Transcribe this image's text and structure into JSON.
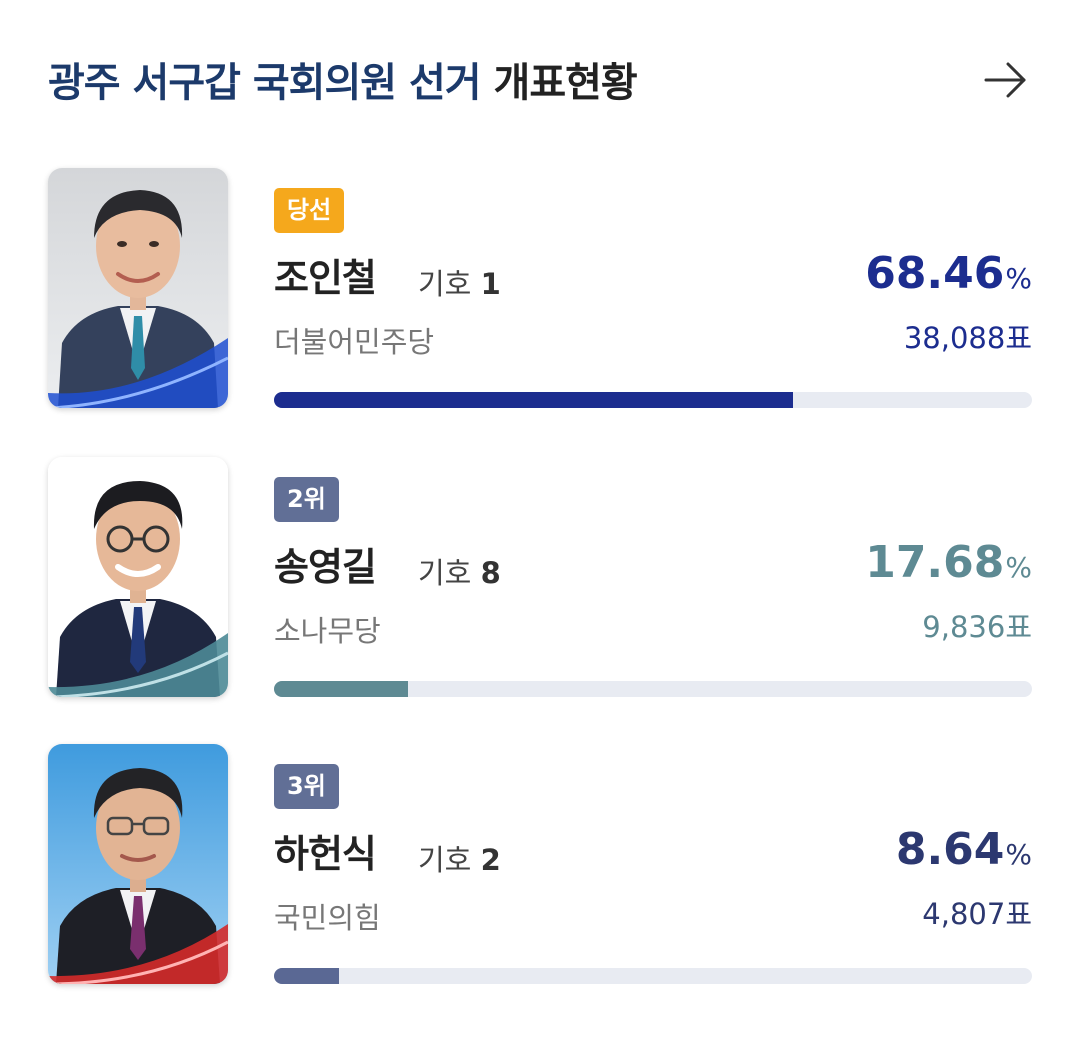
{
  "header": {
    "title_region": "광주 서구갑 국회의원 선거",
    "title_suffix": "개표현황",
    "arrow_icon": "arrow-right-icon"
  },
  "candidates": [
    {
      "badge": "당선",
      "badge_type": "winner",
      "name": "조인철",
      "number_label": "기호",
      "number": "1",
      "party": "더불어민주당",
      "percent": "68.46",
      "percent_unit": "%",
      "votes": "38,088표",
      "share": 0.6846,
      "color": "#1c2d8f",
      "photo_accent": "#1f4fd1"
    },
    {
      "badge": "2위",
      "badge_type": "rank",
      "name": "송영길",
      "number_label": "기호",
      "number": "8",
      "party": "소나무당",
      "percent": "17.68",
      "percent_unit": "%",
      "votes": "9,836표",
      "share": 0.1768,
      "color": "#5e8a93",
      "photo_accent": "#4d8a96"
    },
    {
      "badge": "3위",
      "badge_type": "rank",
      "name": "하헌식",
      "number_label": "기호",
      "number": "2",
      "party": "국민의힘",
      "percent": "8.64",
      "percent_unit": "%",
      "votes": "4,807표",
      "share": 0.0864,
      "color": "#5a6894",
      "photo_accent": "#d42a2a"
    }
  ]
}
